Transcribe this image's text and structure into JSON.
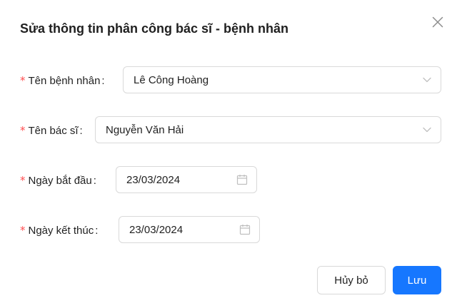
{
  "modal": {
    "title": "Sửa thông tin phân công bác sĩ - bệnh nhân"
  },
  "form": {
    "required_mark": "*",
    "colon": ":",
    "patient": {
      "label": "Tên bệnh nhân",
      "value": "Lê Công Hoàng"
    },
    "doctor": {
      "label": "Tên bác sĩ",
      "value": "Nguyễn Văn Hải"
    },
    "start_date": {
      "label": "Ngày bắt đầu",
      "value": "23/03/2024"
    },
    "end_date": {
      "label": "Ngày kết thúc",
      "value": "23/03/2024"
    }
  },
  "footer": {
    "cancel_label": "Hủy bỏ",
    "save_label": "Lưu"
  },
  "colors": {
    "primary": "#1677ff",
    "required": "#ff4d4f",
    "border": "#d9d9d9"
  },
  "icons": {
    "close": "close-icon",
    "select_arrow": "chevron-down-icon",
    "date_picker": "calendar-icon"
  }
}
